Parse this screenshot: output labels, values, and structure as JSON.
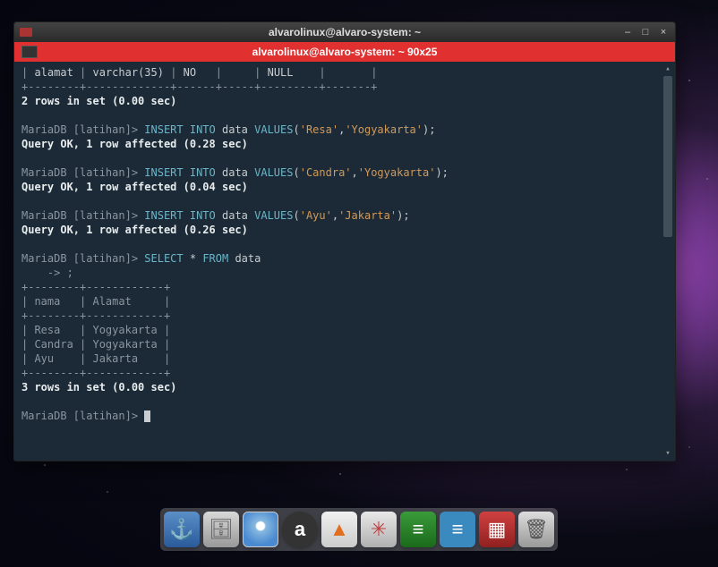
{
  "titlebar": {
    "title": "alvarolinux@alvaro-system: ~"
  },
  "tab": {
    "title": "alvarolinux@alvaro-system: ~ 90x25"
  },
  "win_controls": {
    "min": "–",
    "max": "□",
    "close": "×"
  },
  "scroll": {
    "up": "▴",
    "down": "▾"
  },
  "terminal": {
    "schema_row": {
      "col1": "alamat",
      "col2": "varchar(35)",
      "col3": "NO",
      "col4": "",
      "col5": "NULL",
      "col6": ""
    },
    "rows_header": "2 rows in set (0.00 sec)",
    "prompt": "MariaDB [latihan]>",
    "continuation": "    -> ;",
    "insert1_cmd": "INSERT INTO data VALUES('Resa','Yogyakarta');",
    "insert1_res": "Query OK, 1 row affected (0.28 sec)",
    "insert2_cmd": "INSERT INTO data VALUES('Candra','Yogyakarta');",
    "insert2_res": "Query OK, 1 row affected (0.04 sec)",
    "insert3_cmd": "INSERT INTO data VALUES('Ayu','Jakarta');",
    "insert3_res": "Query OK, 1 row affected (0.26 sec)",
    "select_cmd": "SELECT * FROM data",
    "table": {
      "border": "+--------+------------+",
      "header": "| nama   | Alamat     |",
      "rows": [
        "| Resa   | Yogyakarta |",
        "| Candra | Yogyakarta |",
        "| Ayu    | Jakarta    |"
      ]
    },
    "rows_footer": "3 rows in set (0.00 sec)"
  },
  "dock": {
    "items": [
      {
        "name": "anchor",
        "glyph": "⚓"
      },
      {
        "name": "files",
        "glyph": "🗄"
      },
      {
        "name": "chromium",
        "glyph": ""
      },
      {
        "name": "abiword",
        "glyph": "a"
      },
      {
        "name": "vlc",
        "glyph": "▲"
      },
      {
        "name": "compass",
        "glyph": "✳"
      },
      {
        "name": "calc",
        "glyph": "≡"
      },
      {
        "name": "writer",
        "glyph": "≡"
      },
      {
        "name": "tiles",
        "glyph": "▦"
      },
      {
        "name": "trash",
        "glyph": "🗑"
      }
    ]
  },
  "chart_data": {
    "type": "table",
    "title": "SELECT * FROM data",
    "columns": [
      "nama",
      "Alamat"
    ],
    "rows": [
      [
        "Resa",
        "Yogyakarta"
      ],
      [
        "Candra",
        "Yogyakarta"
      ],
      [
        "Ayu",
        "Jakarta"
      ]
    ]
  }
}
